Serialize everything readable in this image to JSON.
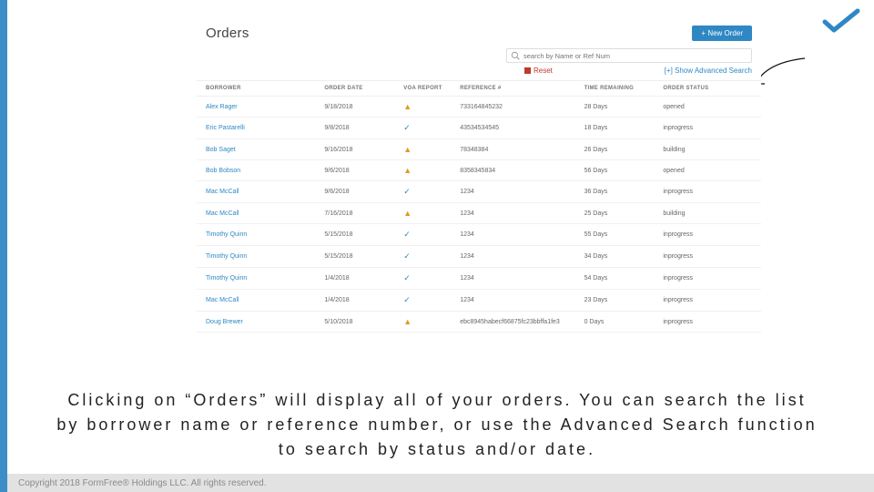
{
  "page": {
    "title": "Orders",
    "new_order_label": "+ New Order"
  },
  "search": {
    "placeholder": "search by Name or Ref Num",
    "reset_label": "Reset",
    "advanced_label": "[+] Show Advanced Search"
  },
  "headers": {
    "borrower": "BORROWER",
    "order_date": "ORDER DATE",
    "voa_report": "VOA REPORT",
    "reference": "REFERENCE #",
    "time_remaining": "TIME REMAINING",
    "order_status": "ORDER STATUS"
  },
  "rows": [
    {
      "borrower": "Alex Rager",
      "order_date": "9/18/2018",
      "voa": "warn",
      "reference": "733164845232",
      "time_remaining": "28 Days",
      "order_status": "opened"
    },
    {
      "borrower": "Eric Pastarelli",
      "order_date": "9/8/2018",
      "voa": "ok",
      "reference": "43534534545",
      "time_remaining": "18 Days",
      "order_status": "inprogress"
    },
    {
      "borrower": "Bob Saget",
      "order_date": "9/16/2018",
      "voa": "warn",
      "reference": "78348384",
      "time_remaining": "26 Days",
      "order_status": "building"
    },
    {
      "borrower": "Bob Bobson",
      "order_date": "9/6/2018",
      "voa": "warn",
      "reference": "8358345834",
      "time_remaining": "56 Days",
      "order_status": "opened"
    },
    {
      "borrower": "Mac McCall",
      "order_date": "9/6/2018",
      "voa": "ok",
      "reference": "1234",
      "time_remaining": "36 Days",
      "order_status": "inprogress"
    },
    {
      "borrower": "Mac McCall",
      "order_date": "7/16/2018",
      "voa": "warn",
      "reference": "1234",
      "time_remaining": "25 Days",
      "order_status": "building"
    },
    {
      "borrower": "Timothy Quinn",
      "order_date": "5/15/2018",
      "voa": "ok",
      "reference": "1234",
      "time_remaining": "55 Days",
      "order_status": "inprogress"
    },
    {
      "borrower": "Timothy Quinn",
      "order_date": "5/15/2018",
      "voa": "ok",
      "reference": "1234",
      "time_remaining": "34 Days",
      "order_status": "inprogress"
    },
    {
      "borrower": "Timothy Quinn",
      "order_date": "1/4/2018",
      "voa": "ok",
      "reference": "1234",
      "time_remaining": "54 Days",
      "order_status": "inprogress"
    },
    {
      "borrower": "Mac McCall",
      "order_date": "1/4/2018",
      "voa": "ok",
      "reference": "1234",
      "time_remaining": "23 Days",
      "order_status": "inprogress"
    },
    {
      "borrower": "Doug Brewer",
      "order_date": "5/10/2018",
      "voa": "warn",
      "reference": "ebc8945habecf66875fc23bbffa1fe3",
      "time_remaining": "0 Days",
      "order_status": "inprogress"
    }
  ],
  "caption_text": "Clicking on “Orders” will display all of your orders. You can search the list by borrower name or reference number, or use the Advanced Search function to search by status and/or date.",
  "footer_text": "Copyright 2018 FormFree® Holdings LLC. All rights reserved."
}
